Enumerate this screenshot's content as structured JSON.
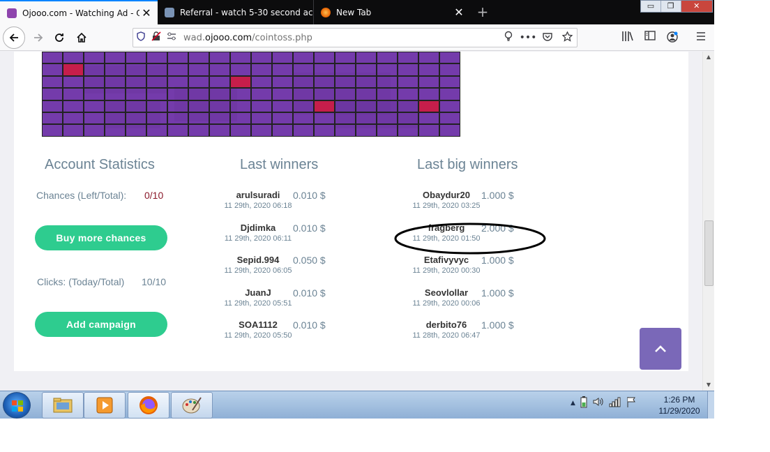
{
  "browser": {
    "tabs": [
      {
        "title": "Ojooo.com - Watching Ad - Oj",
        "active": true,
        "close": "✕"
      },
      {
        "title": "Referral - watch 5-30 second ac",
        "active": false,
        "close": ""
      },
      {
        "title": "New Tab",
        "active": false,
        "close": "✕"
      }
    ],
    "new_tab_glyph": "+",
    "window_controls": {
      "minimize": "▭",
      "restore": "❐",
      "close": "✕"
    },
    "url_prefix": "wad.",
    "url_domain": "ojooo.com",
    "url_path": "/cointoss.php"
  },
  "page": {
    "account": {
      "title": "Account Statistics",
      "chances_label": "Chances (Left/Total):",
      "chances_value": "0/10",
      "buy_button": "Buy more chances",
      "clicks_label": "Clicks: (Today/Total)",
      "clicks_value": "10/10",
      "campaign_button": "Add campaign"
    },
    "last_winners": {
      "title": "Last winners",
      "rows": [
        {
          "name": "arulsuradi",
          "amount": "0.010 $",
          "date": "11 29th, 2020 06:18"
        },
        {
          "name": "Djdimka",
          "amount": "0.010 $",
          "date": "11 29th, 2020 06:11"
        },
        {
          "name": "Sepid.994",
          "amount": "0.050 $",
          "date": "11 29th, 2020 06:05"
        },
        {
          "name": "JuanJ",
          "amount": "0.010 $",
          "date": "11 29th, 2020 05:51"
        },
        {
          "name": "SOA1112",
          "amount": "0.010 $",
          "date": "11 29th, 2020 05:50"
        }
      ]
    },
    "last_big_winners": {
      "title": "Last big winners",
      "rows": [
        {
          "name": "Obaydur20",
          "amount": "1.000 $",
          "date": "11 29th, 2020 03:25"
        },
        {
          "name": "fragberg",
          "amount": "2.000 $",
          "date": "11 29th, 2020 01:50"
        },
        {
          "name": "Etafivyvyc",
          "amount": "1.000 $",
          "date": "11 29th, 2020 00:30"
        },
        {
          "name": "Seovlollar",
          "amount": "1.000 $",
          "date": "11 29th, 2020 00:06"
        },
        {
          "name": "derbito76",
          "amount": "1.000 $",
          "date": "11 28th, 2020 06:47"
        }
      ]
    },
    "scroll_top_glyph": "^"
  },
  "taskbar": {
    "time": "1:26 PM",
    "date": "11/29/2020"
  },
  "colors": {
    "accent_green": "#2ecc8f",
    "muted_text": "#6b8394",
    "chances_value": "#8b1a2b",
    "grid_hit": "#c61e4b",
    "scroll_button": "#7a68b8"
  }
}
